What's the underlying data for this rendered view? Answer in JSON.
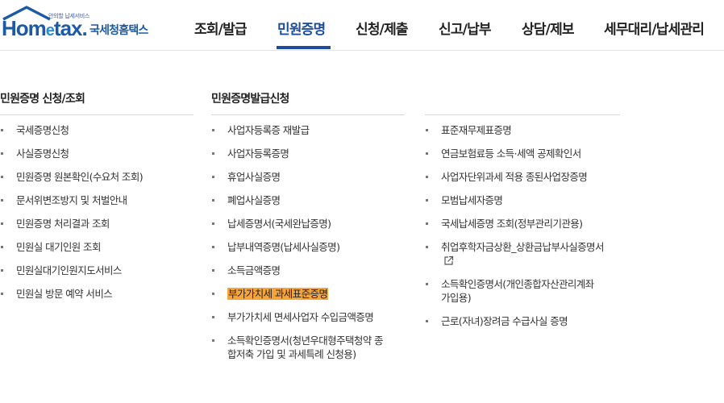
{
  "logo": {
    "tagline": "안의할 납세서비스",
    "brand_main": "Hom",
    "brand_e": "e",
    "brand_tail": "tax.",
    "site_name": "국세청홈택스"
  },
  "nav": {
    "items": [
      "조회/발급",
      "민원증명",
      "신청/제출",
      "신고/납부",
      "상담/제보",
      "세무대리/납세관리"
    ],
    "active": "민원증명"
  },
  "columns": {
    "col1": {
      "title": "민원증명 신청/조회",
      "items": [
        "국세증명신청",
        "사실증명신청",
        "민원증명 원본확인(수요처 조회)",
        "문서위변조방지 및 처벌안내",
        "민원증명 처리결과 조회",
        "민원실 대기인원 조회",
        "민원실대기인원지도서비스",
        "민원실 방문 예약 서비스"
      ]
    },
    "col2": {
      "title": "민원증명발급신청",
      "items": [
        "사업자등록증 재발급",
        "사업자등록증명",
        "휴업사실증명",
        "폐업사실증명",
        "납세증명서(국세완납증명)",
        "납부내역증명(납세사실증명)",
        "소득금액증명",
        "부가가치세 과세표준증명",
        "부가가치세 면세사업자 수입금액증명",
        "소득확인증명서(청년우대형주택청약 종합저축 가입 및 과세특례 신청용)"
      ],
      "highlighted": "부가가치세 과세표준증명"
    },
    "col3": {
      "items": [
        "표준재무제표증명",
        "연금보험료등 소득·세액 공제확인서",
        "사업자단위과세 적용 종된사업장증명",
        "모범납세자증명",
        "국세납세증명 조회(정부관리기관용)",
        "취업후학자금상환_상환금납부사실증명서",
        "소득확인증명서(개인종합자산관리계좌 가입용)",
        "근로(자녀)장려금 수급사실 증명"
      ]
    }
  },
  "colors": {
    "accent": "#1d4e9e",
    "highlight": "#f7a43a"
  },
  "icons": {
    "external_link": "external-link-icon"
  }
}
